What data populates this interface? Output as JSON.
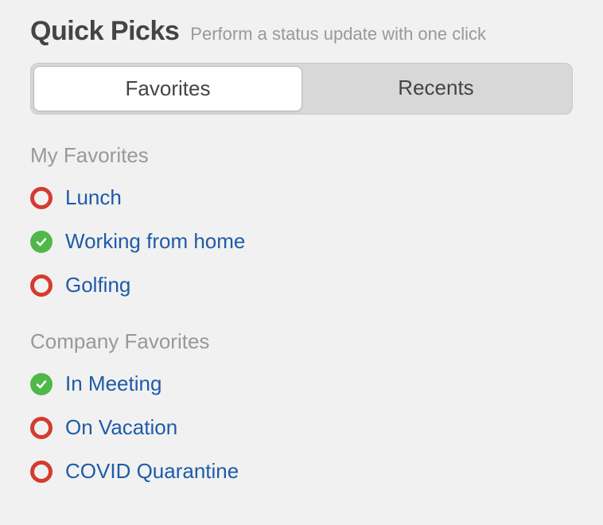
{
  "header": {
    "title": "Quick Picks",
    "subtitle": "Perform a status update with one click"
  },
  "tabs": [
    {
      "label": "Favorites",
      "active": true
    },
    {
      "label": "Recents",
      "active": false
    }
  ],
  "sections": [
    {
      "title": "My Favorites",
      "items": [
        {
          "label": "Lunch",
          "icon": "ring"
        },
        {
          "label": "Working from home",
          "icon": "check"
        },
        {
          "label": "Golfing",
          "icon": "ring"
        }
      ]
    },
    {
      "title": "Company Favorites",
      "items": [
        {
          "label": "In Meeting",
          "icon": "check"
        },
        {
          "label": "On Vacation",
          "icon": "ring"
        },
        {
          "label": "COVID Quarantine",
          "icon": "ring"
        }
      ]
    }
  ]
}
